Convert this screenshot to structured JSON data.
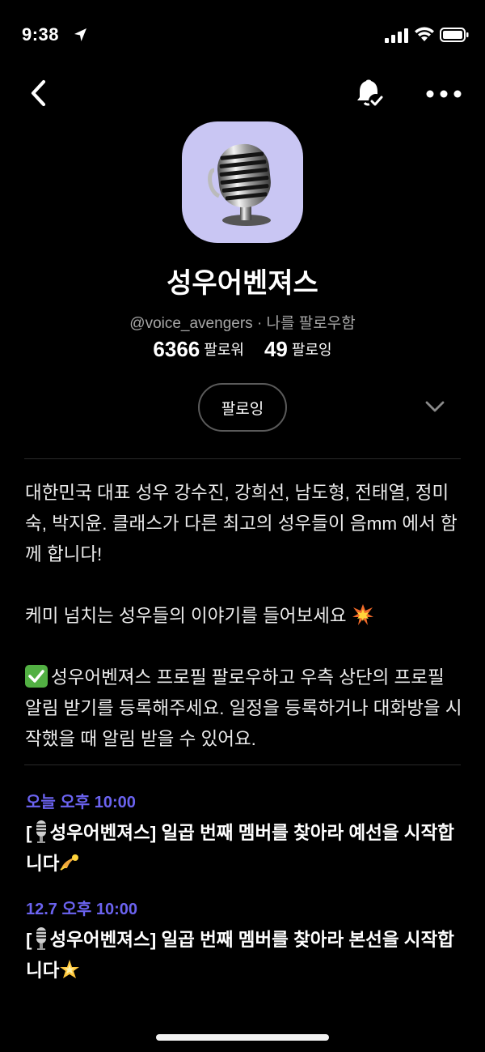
{
  "status": {
    "time": "9:38"
  },
  "profile": {
    "name": "성우어벤져스",
    "handle": "@voice_avengers",
    "follow_note": "· 나를 팔로우함",
    "followers_count": "6366",
    "followers_label": "팔로워",
    "following_count": "49",
    "following_label": "팔로잉",
    "follow_button_label": "팔로잉"
  },
  "bio": {
    "para1": "대한민국 대표 성우 강수진, 강희선, 남도형, 전태열, 정미숙, 박지윤. 클래스가 다른 최고의 성우들이 음mm 에서 함께 합니다!",
    "para2": "케미 넘치는 성우들의 이야기를 들어보세요",
    "para3": "성우어벤져스 프로필 팔로우하고 우측 상단의 프로필 알림 받기를 등록해주세요. 일정을 등록하거나 대화방을 시작했을 때 알림 받을 수 있어요."
  },
  "schedule": [
    {
      "time": "오늘 오후 10:00",
      "open": "[",
      "title": "성우어벤져스] 일곱 번째 멤버를 찾아라 예선을 시작합니다"
    },
    {
      "time": "12.7 오후 10:00",
      "open": "[",
      "title": "성우어벤져스] 일곱 번째 멤버를 찾아라 본선을 시작합니다"
    }
  ],
  "icons": {
    "location": "location-arrow-icon",
    "signal": "cellular-signal-icon",
    "wifi": "wifi-icon",
    "battery": "battery-icon",
    "back": "back-chevron-icon",
    "bell": "bell-check-icon",
    "more": "more-dots-icon",
    "avatar": "microphone-icon",
    "expand": "chevron-down-icon"
  },
  "colors": {
    "background": "#000000",
    "avatar_bg": "#c9c6f3",
    "accent_time": "#6b63f0",
    "muted_text": "#a7a7a7"
  }
}
